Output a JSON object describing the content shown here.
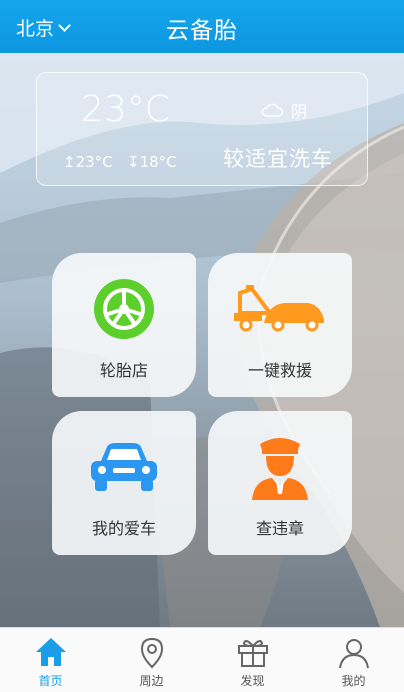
{
  "header": {
    "city": "北京",
    "title": "云备胎"
  },
  "weather": {
    "temperature": "23°C",
    "high": "23°C",
    "low": "18°C",
    "condition": "阴",
    "condition_icon": "cloud-icon",
    "car_wash_advice": "较适宜洗车"
  },
  "tiles": [
    {
      "label": "轮胎店",
      "icon": "tire-icon",
      "color": "#5ccf2d"
    },
    {
      "label": "一键救援",
      "icon": "tow-truck-icon",
      "color": "#ff9a1f"
    },
    {
      "label": "我的爱车",
      "icon": "car-icon",
      "color": "#2b97f0"
    },
    {
      "label": "查违章",
      "icon": "traffic-officer-icon",
      "color": "#ff7b1a"
    }
  ],
  "tabbar": {
    "active_color": "#1a9ee8",
    "items": [
      {
        "label": "首页",
        "icon": "home-icon",
        "active": true
      },
      {
        "label": "周边",
        "icon": "location-pin-icon",
        "active": false
      },
      {
        "label": "发现",
        "icon": "gift-icon",
        "active": false
      },
      {
        "label": "我的",
        "icon": "user-icon",
        "active": false
      }
    ]
  }
}
